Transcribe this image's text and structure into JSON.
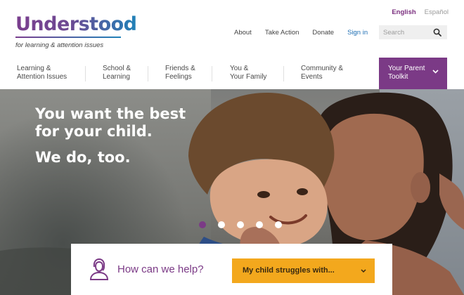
{
  "brand": {
    "name": "Understood",
    "tagline": "for learning & attention issues"
  },
  "language": {
    "active": "English",
    "alternate": "Español"
  },
  "utility_nav": {
    "about": "About",
    "take_action": "Take Action",
    "donate": "Donate",
    "sign_in": "Sign in"
  },
  "search": {
    "placeholder": "Search",
    "icon": "search-icon"
  },
  "main_nav": {
    "items": [
      {
        "line1": "Learning &",
        "line2": "Attention Issues"
      },
      {
        "line1": "School &",
        "line2": "Learning"
      },
      {
        "line1": "Friends &",
        "line2": "Feelings"
      },
      {
        "line1": "You &",
        "line2": "Your Family"
      },
      {
        "line1": "Community &",
        "line2": "Events"
      }
    ],
    "toolkit": {
      "line1": "Your Parent",
      "line2": "Toolkit",
      "icon": "chevron-down-icon"
    }
  },
  "hero": {
    "headline_line1": "You want the best",
    "headline_line2": "for your child.",
    "subheadline": "We do, too.",
    "carousel_slides": 5,
    "carousel_active": 1
  },
  "help": {
    "icon": "person-icon",
    "prompt": "How can we help?",
    "select_value": "My child struggles with..."
  },
  "colors": {
    "brand_purple": "#7b3a86",
    "link_blue": "#1f6fb4",
    "cta_yellow": "#f3a81d"
  }
}
